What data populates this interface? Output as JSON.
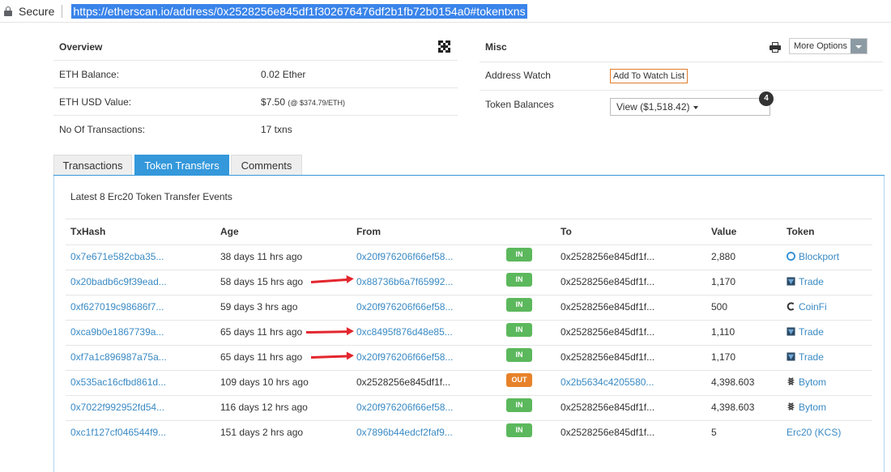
{
  "browser": {
    "secure_label": "Secure",
    "url": "https://etherscan.io/address/0x2528256e845df1f302676476df2b1fb72b0154a0#tokentxns"
  },
  "overview": {
    "title": "Overview",
    "rows": [
      {
        "label": "ETH Balance:",
        "value": "0.02 Ether",
        "extra": ""
      },
      {
        "label": "ETH USD Value:",
        "value": "$7.50",
        "extra": "(@ $374.79/ETH)"
      },
      {
        "label": "No Of Transactions:",
        "value": "17 txns",
        "extra": ""
      }
    ]
  },
  "misc": {
    "title": "Misc",
    "more_options": "More Options",
    "address_watch_label": "Address Watch",
    "add_watch_button": "Add To Watch List",
    "token_balances_label": "Token Balances",
    "token_balances_value": "View ($1,518.42)",
    "token_count": "4"
  },
  "tabs": [
    "Transactions",
    "Token Transfers",
    "Comments"
  ],
  "active_tab": "Token Transfers",
  "events_title": "Latest 8 Erc20 Token Transfer Events",
  "columns": [
    "TxHash",
    "Age",
    "From",
    "To",
    "Value",
    "Token"
  ],
  "rows": [
    {
      "hash": "0x7e671e582cba35...",
      "age": "38 days 11 hrs ago",
      "from": "0x20f976206f66ef58...",
      "from_link": true,
      "dir": "IN",
      "to": "0x2528256e845df1f...",
      "to_link": false,
      "value": "2,880",
      "token": "Blockport",
      "token_icon": "blockport-icon",
      "token_link": true
    },
    {
      "hash": "0x20badb6c9f39ead...",
      "age": "58 days 15 hrs ago",
      "from": "0x88736b6a7f65992...",
      "from_link": true,
      "dir": "IN",
      "to": "0x2528256e845df1f...",
      "to_link": false,
      "value": "1,170",
      "token": "Trade",
      "token_icon": "trade-icon",
      "token_link": true
    },
    {
      "hash": "0xf627019c98686f7...",
      "age": "59 days 3 hrs ago",
      "from": "0x20f976206f66ef58...",
      "from_link": true,
      "dir": "IN",
      "to": "0x2528256e845df1f...",
      "to_link": false,
      "value": "500",
      "token": "CoinFi",
      "token_icon": "coinfi-icon",
      "token_link": true
    },
    {
      "hash": "0xca9b0e1867739a...",
      "age": "65 days 11 hrs ago",
      "from": "0xc8495f876d48e85...",
      "from_link": true,
      "dir": "IN",
      "to": "0x2528256e845df1f...",
      "to_link": false,
      "value": "1,110",
      "token": "Trade",
      "token_icon": "trade-icon",
      "token_link": true
    },
    {
      "hash": "0xf7a1c896987a75a...",
      "age": "65 days 11 hrs ago",
      "from": "0x20f976206f66ef58...",
      "from_link": true,
      "dir": "IN",
      "to": "0x2528256e845df1f...",
      "to_link": false,
      "value": "1,170",
      "token": "Trade",
      "token_icon": "trade-icon",
      "token_link": true
    },
    {
      "hash": "0x535ac16cfbd861d...",
      "age": "109 days 10 hrs ago",
      "from": "0x2528256e845df1f...",
      "from_link": false,
      "dir": "OUT",
      "to": "0x2b5634c4205580...",
      "to_link": true,
      "value": "4,398.603",
      "token": "Bytom",
      "token_icon": "bytom-icon",
      "token_link": true
    },
    {
      "hash": "0x7022f992952fd54...",
      "age": "116 days 12 hrs ago",
      "from": "0x20f976206f66ef58...",
      "from_link": true,
      "dir": "IN",
      "to": "0x2528256e845df1f...",
      "to_link": false,
      "value": "4,398.603",
      "token": "Bytom",
      "token_icon": "bytom-icon",
      "token_link": true
    },
    {
      "hash": "0xc1f127cf046544f9...",
      "age": "151 days 2 hrs ago",
      "from": "0x7896b44edcf2faf9...",
      "from_link": true,
      "dir": "IN",
      "to": "0x2528256e845df1f...",
      "to_link": false,
      "value": "5",
      "token": "Erc20 (KCS)",
      "token_icon": "",
      "token_link": true
    }
  ],
  "colors": {
    "link": "#3a8ac4",
    "tab_active": "#3498db",
    "in_badge": "#5cb85c",
    "out_badge": "#e7822a",
    "annotation_arrow": "#e3262d"
  }
}
